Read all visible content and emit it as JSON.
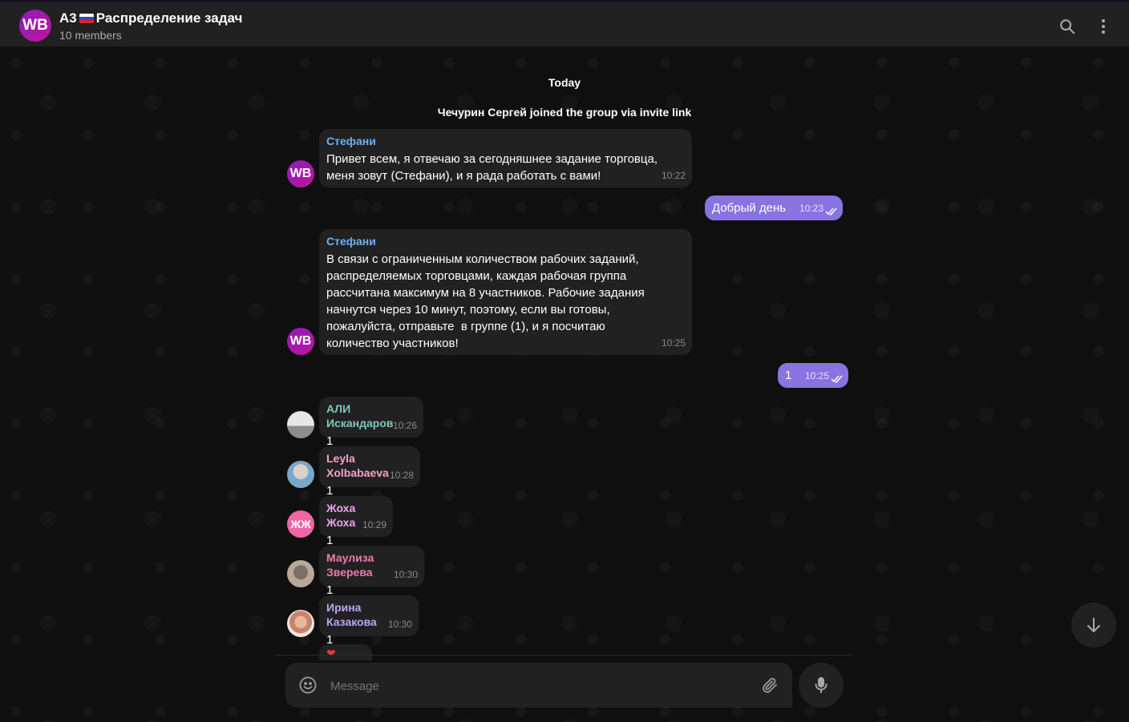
{
  "header": {
    "avatar_text": "WB",
    "title_prefix": "A3",
    "title_main": "Распределение задач",
    "subtitle": "10 members",
    "icons": [
      "search-icon",
      "more-vertical-icon"
    ]
  },
  "chat": {
    "date_label": "Today",
    "service_message": "Чечурин Сергей joined the group via invite link",
    "messages": [
      {
        "sender": "Стефани",
        "avatar_text": "WB",
        "text": "Привет всем, я отвечаю за сегодняшнее задание торговца,\nменя зовут (Стефани), и я рада работать с вами!",
        "time": "10:22"
      },
      {
        "text": "Добрый день",
        "time": "10:23"
      },
      {
        "sender": "Стефани",
        "avatar_text": "WB",
        "text": "В связи с ограниченным количеством рабочих заданий,\nраспределяемых торговцами, каждая рабочая группа\nрассчитана максимум на 8 участников. Рабочие задания\nначнутся через 10 минут, поэтому, если вы готовы,\nпожалуйста, отправьте  в группе (1), и я посчитаю\nколичество участников!",
        "time": "10:25"
      },
      {
        "text": "1",
        "time": "10:25"
      },
      {
        "sender": "АЛИ Искандаров",
        "text": "1",
        "time": "10:26"
      },
      {
        "sender": "Leyla Xolbabaeva",
        "text": "1",
        "time": "10:28"
      },
      {
        "sender": "Жоха Жоха",
        "avatar_text": "ЖЖ",
        "text": "1",
        "time": "10:29"
      },
      {
        "sender": "Маулиза Зверева",
        "text": "1",
        "time": "10:30"
      },
      {
        "sender": "Ирина Казакова",
        "text": "1",
        "time": "10:30"
      }
    ],
    "partial_reaction": "❤"
  },
  "composer": {
    "placeholder": "Message",
    "icons": [
      "emoji-icon",
      "paperclip-icon",
      "microphone-icon",
      "arrow-down-icon"
    ]
  },
  "colors": {
    "outgoing_bubble": "#8774e1",
    "incoming_bubble": "#212121",
    "sender_stefani": "#6ab2f2",
    "sender_ali": "#7ec9b8",
    "sender_leyla": "#f4a3c7",
    "sender_zhoha": "#e9a6e8",
    "sender_mauliza": "#ee7aae",
    "sender_irina": "#b9a7f3"
  }
}
